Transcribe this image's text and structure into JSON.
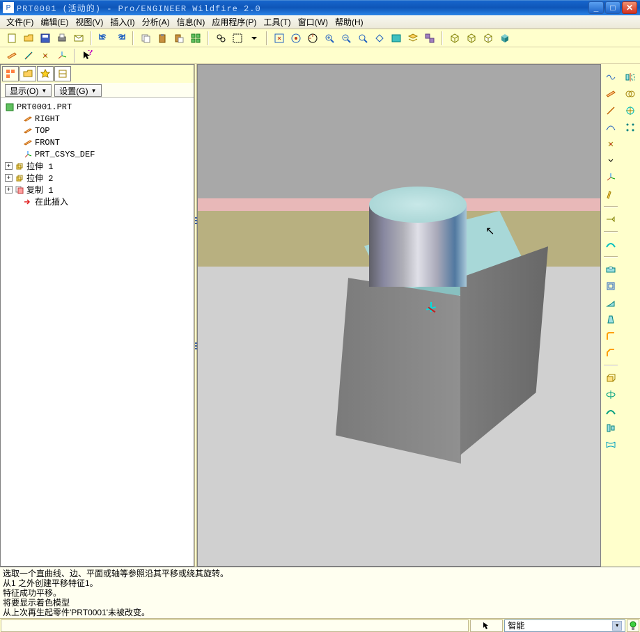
{
  "title": "PRT0001 (活动的) - Pro/ENGINEER Wildfire 2.0",
  "menus": {
    "file": "文件(F)",
    "edit": "编辑(E)",
    "view": "视图(V)",
    "insert": "插入(I)",
    "analyze": "分析(A)",
    "info": "信息(N)",
    "app": "应用程序(P)",
    "tools": "工具(T)",
    "window": "窗口(W)",
    "help": "帮助(H)"
  },
  "left_buttons": {
    "display": "显示(O)",
    "settings": "设置(G)"
  },
  "tree": {
    "root": "PRT0001.PRT",
    "items": [
      {
        "icon": "plane",
        "label": "RIGHT"
      },
      {
        "icon": "plane",
        "label": "TOP"
      },
      {
        "icon": "plane",
        "label": "FRONT"
      },
      {
        "icon": "csys",
        "label": "PRT_CSYS_DEF"
      },
      {
        "icon": "feat",
        "label": "拉伸 1",
        "exp": true
      },
      {
        "icon": "feat",
        "label": "拉伸 2",
        "exp": true
      },
      {
        "icon": "copy",
        "label": "复制 1",
        "exp": true
      },
      {
        "icon": "insert",
        "label": "在此插入"
      }
    ]
  },
  "messages": [
    "选取一个直曲线、边、平面或轴等参照沿其平移或绕其旋转。",
    "从1 之外创建平移特征1。",
    "特征成功平移。",
    "将要显示着色模型",
    "从上次再生起零件'PRT0001'未被改变。"
  ],
  "status": {
    "combo": "智能"
  }
}
